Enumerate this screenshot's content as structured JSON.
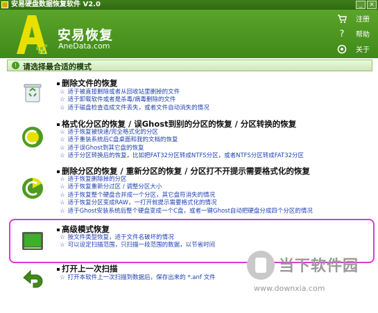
{
  "window": {
    "title": "安易硬盘数据恢复软件 V2.0"
  },
  "header": {
    "logo_cn": "安易恢复",
    "logo_en": "AneData.com",
    "links": [
      {
        "label": "注册",
        "icon": "cart-icon"
      },
      {
        "label": "帮助",
        "icon": "question-icon"
      },
      {
        "label": "关于",
        "icon": "about-icon"
      }
    ]
  },
  "section": {
    "title": "请选择最合适的模式"
  },
  "options": [
    {
      "title": "删除文件的恢复",
      "icon": "recycle-bin-icon",
      "bullets": [
        "适于被直接删除或者从回收站里删掉的文件",
        "适于卸载软件或者是杀毒/病毒删除的文件",
        "适于磁盘检查造成文件丢失，或者文件自动消失的情况"
      ]
    },
    {
      "title": "格式化分区的恢复 / 误Ghost到别的分区的恢复 / 分区转换的恢复",
      "icon": "format-disk-icon",
      "bullets": [
        "适于恢复被快速/完全格式化的分区",
        "适于重装系统后C盘桌面和我的文档的恢复",
        "适于误Ghost到其它盘的恢复",
        "适于分区转换后的恢复，比如把FAT32分区转成NTFS分区，或者NTFS分区转成FAT32分区"
      ]
    },
    {
      "title": "删除分区的恢复 / 重新分区的恢复 / 分区打不开提示需要格式化的恢复",
      "icon": "partition-icon",
      "bullets": [
        "适于恢复删除掉的分区",
        "适于恢复重新分过区 / 调整分区大小",
        "适于恢复整个硬盘合并成一个分区，其它盘符消失的情况",
        "适于恢复分区变成RAW，一打开就提示需要格式化的情况",
        "适于Ghost安装系统后整个硬盘变成一个C盘，或者一键Ghost自动把硬盘分成四个分区的情况"
      ]
    },
    {
      "title": "高级模式恢复",
      "icon": "hard-drive-icon",
      "bullets": [
        "按文件类型恢复，适于文件名破坏的情况",
        "可以设定扫描范围，只扫描一段范围的数据，以节省时间"
      ]
    },
    {
      "title": "打开上一次扫描",
      "icon": "back-arrow-icon",
      "bullets": [
        "打开本软件上一次扫描到数据后，保存出来的 *.anf 文件"
      ]
    }
  ],
  "watermark": {
    "text": "当下软件园",
    "url": "www.downxia.com"
  },
  "colors": {
    "brand_green": "#4f9a20",
    "link_blue": "#1f3fb0",
    "highlight": "#d63ad6"
  }
}
